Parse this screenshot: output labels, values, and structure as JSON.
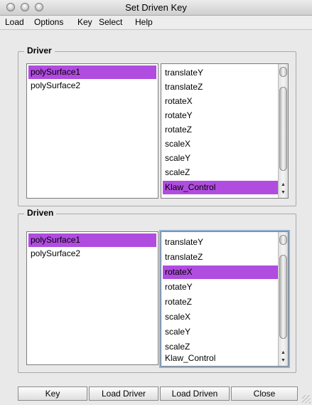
{
  "window": {
    "title": "Set Driven Key"
  },
  "menu": [
    "Load",
    "Options",
    "Key",
    "Select",
    "Help"
  ],
  "driver": {
    "label": "Driver",
    "objects": [
      "polySurface1",
      "polySurface2"
    ],
    "selected_object": 0,
    "attributes": [
      "translateY",
      "translateZ",
      "rotateX",
      "rotateY",
      "rotateZ",
      "scaleX",
      "scaleY",
      "scaleZ",
      "Klaw_Control"
    ],
    "selected_attribute": 8
  },
  "driven": {
    "label": "Driven",
    "objects": [
      "polySurface1",
      "polySurface2"
    ],
    "selected_object": 0,
    "attributes": [
      "translateY",
      "translateZ",
      "rotateX",
      "rotateY",
      "rotateZ",
      "scaleX",
      "scaleY",
      "scaleZ",
      "Klaw_Control"
    ],
    "selected_attribute": 2
  },
  "buttons": [
    "Key",
    "Load Driver",
    "Load Driven",
    "Close"
  ],
  "colors": {
    "selection": "#b04ce0",
    "window_bg": "#e9e9e9"
  }
}
